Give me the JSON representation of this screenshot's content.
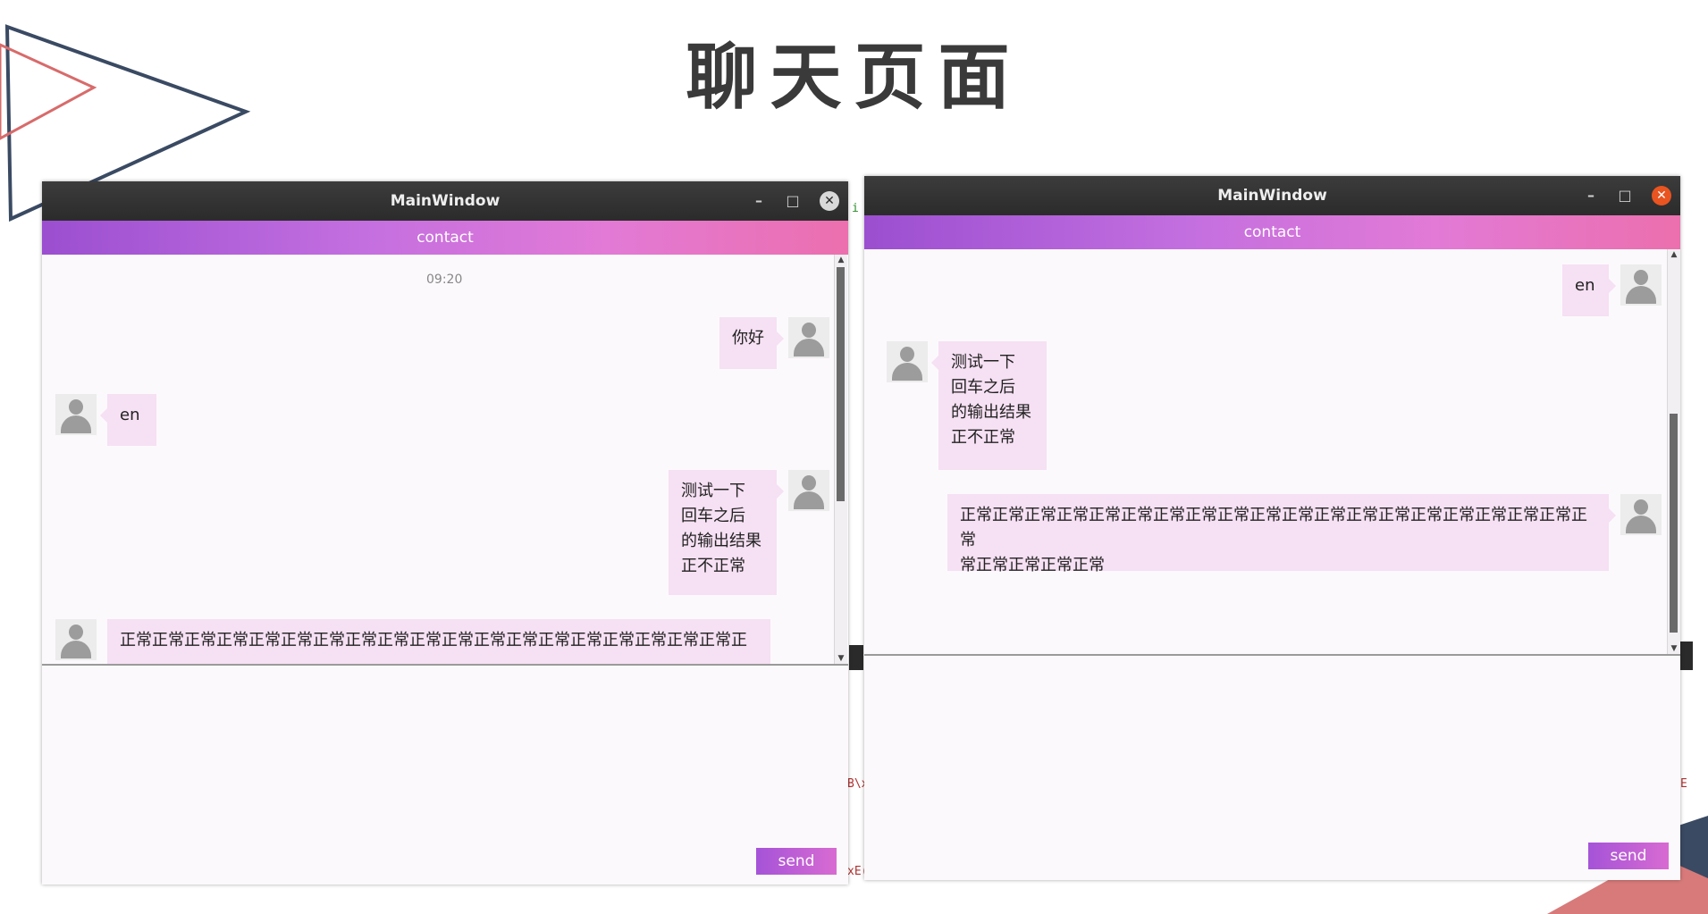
{
  "slide": {
    "title": "聊天页面"
  },
  "windows": [
    {
      "title": "MainWindow",
      "minimize": "–",
      "maximize": "□",
      "close": "✕",
      "contact": "contact",
      "timestamp": "09:20",
      "messages": [
        {
          "side": "right",
          "text": "你好"
        },
        {
          "side": "left",
          "text": "en"
        },
        {
          "side": "right",
          "text": "测试一下\n回车之后\n的输出结果\n正不正常"
        },
        {
          "side": "left",
          "text": "正常正常正常正常正常正常正常正常正常正常正常正常正常正常正常正常正常正常正常正"
        }
      ],
      "input_value": "",
      "send": "send"
    },
    {
      "title": "MainWindow",
      "minimize": "–",
      "maximize": "□",
      "close": "✕",
      "contact": "contact",
      "messages": [
        {
          "side": "right",
          "text": "en"
        },
        {
          "side": "left",
          "text": "测试一下\n回车之后\n的输出结果\n正不正常"
        },
        {
          "side": "right",
          "text": "正常正常正常正常正常正常正常正常正常正常正常正常正常正常正常正常正常正常正常正常\n常正常正常正常正常"
        }
      ],
      "input_value": "",
      "send": "send"
    }
  ],
  "background_fragments": [
    "i",
    "B\\x",
    "xE(",
    "E"
  ],
  "colors": {
    "titlebar": "#2f2f2f",
    "contact_gradient_start": "#9b4fd0",
    "contact_gradient_end": "#ec6fae",
    "bubble": "#f6e0f3",
    "close_active": "#e95420",
    "deco_navy": "#3a4a63",
    "deco_red": "#d86b6b"
  },
  "icons": {
    "avatar": "default-user-avatar-icon",
    "close": "close-icon",
    "minimize": "minimize-icon",
    "maximize": "maximize-icon"
  }
}
